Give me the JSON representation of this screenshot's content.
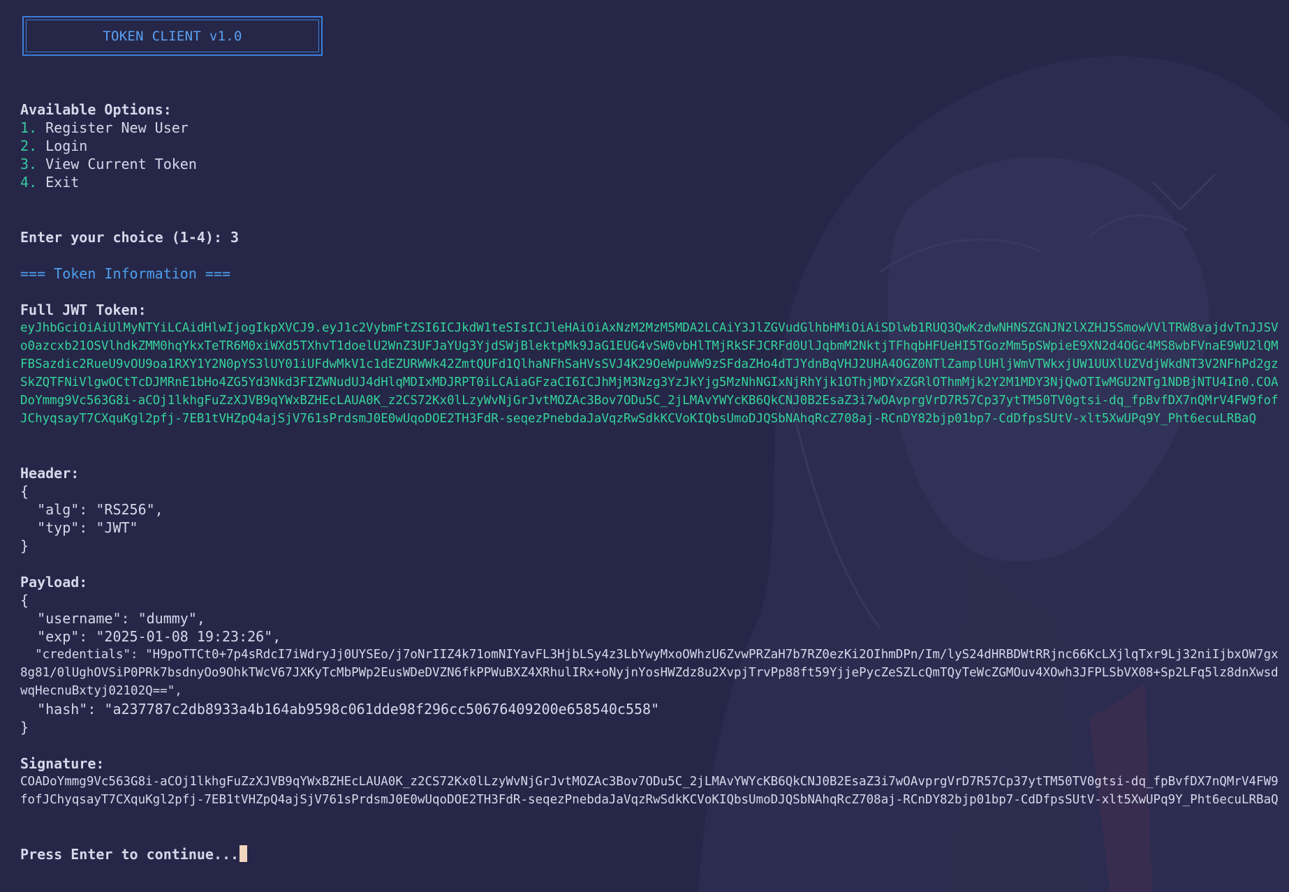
{
  "banner": {
    "title": "TOKEN CLIENT v1.0"
  },
  "menu": {
    "heading": "Available Options:",
    "options": [
      {
        "number": "1.",
        "label": "Register New User"
      },
      {
        "number": "2.",
        "label": "Login"
      },
      {
        "number": "3.",
        "label": "View Current Token"
      },
      {
        "number": "4.",
        "label": "Exit"
      }
    ]
  },
  "prompt": {
    "text": "Enter your choice (1-4):",
    "value": "3"
  },
  "token_info": {
    "heading": "=== Token Information ===",
    "full_token_label": "Full JWT Token:",
    "full_token": "eyJhbGciOiAiUlMyNTYiLCAidHlwIjogIkpXVCJ9.eyJ1c2VybmFtZSI6ICJkdW1teSIsICJleHAiOiAxNzM2MzM5MDA2LCAiY3JlZGVudGlhbHMiOiAiSDlwb1RUQ3QwKzdwNHNSZGNJN2lXZHJ5SmowVVlTRW8vajdvTnJJSVo0azcxb21OSVlhdkZMM0hqYkxTeTR6M0xiWXd5TXhvT1doelU2WnZ3UFJaYUg3YjdSWjBlektpMk9JaG1EUG4vSW0vbHlTMjRkSFJCRFd0UlJqbmM2NktjTFhqbHFUeHI5TGozMm5pSWpieE9XN2d4OGc4MS8wbFVnaE9WU2lQMFBSazdic2RueU9vOU9oa1RXY1Y2N0pYS3lUY01iUFdwMkV1c1dEZURWWk42ZmtQUFd1QlhaNFhSaHVsSVJ4K29OeWpuWW9zSFdaZHo4dTJYdnBqVHJ2UHA4OGZ0NTlZamplUHljWmVTWkxjUW1UUXlUZVdjWkdNT3V2NFhPd2gzSkZQTFNiVlgwOCtTcDJMRnE1bHo4ZG5Yd3Nkd3FIZWNudUJ4dHlqMDIxMDJRPT0iLCAiaGFzaCI6ICJhMjM3Nzg3YzJkYjg5MzNhNGIxNjRhYjk1OThjMDYxZGRlOThmMjk2Y2M1MDY3NjQwOTIwMGU2NTg1NDBjNTU4In0.COADoYmmg9Vc563G8i-aCOj1lkhgFuZzXJVB9qYWxBZHEcLAUA0K_z2CS72Kx0lLzyWvNjGrJvtMOZAc3Bov7ODu5C_2jLMAvYWYcKB6QkCNJ0B2EsaZ3i7wOAvprgVrD7R57Cp37ytTM50TV0gtsi-dq_fpBvfDX7nQMrV4FW9fofJChyqsayT7CXquKgl2pfj-7EB1tVHZpQ4ajSjV761sPrdsmJ0E0wUqoDOE2TH3FdR-seqezPnebdaJaVqzRwSdkKCVoKIQbsUmoDJQSbNAhqRcZ708aj-RCnDY82bjp01bp7-CdDfpsSUtV-xlt5XwUPq9Y_Pht6ecuLRBaQ",
    "header_label": "Header:",
    "header_lines": [
      "{",
      "  \"alg\": \"RS256\",",
      "  \"typ\": \"JWT\"",
      "}"
    ],
    "payload_label": "Payload:",
    "payload_open": "{",
    "payload_username": "  \"username\": \"dummy\",",
    "payload_exp": "  \"exp\": \"2025-01-08 19:23:26\",",
    "payload_credentials": "  \"credentials\": \"H9poTTCt0+7p4sRdcI7iWdryJj0UYSEo/j7oNrIIZ4k71omNIYavFL3HjbLSy4z3LbYwyMxoOWhzU6ZvwPRZaH7b7RZ0ezKi2OIhmDPn/Im/lyS24dHRBDWtRRjnc66KcLXjlqTxr9Lj32niIjbxOW7gx8g81/0lUghOVSiP0PRk7bsdnyOo9OhkTWcV67JXKyTcMbPWp2EusWDeDVZN6fkPPWuBXZ4XRhulIRx+oNyjnYosHWZdz8u2XvpjTrvPp88ft59YjjePycZeSZLcQmTQyTeWcZGMOuv4XOwh3JFPLSbVX08+Sp2LFq5lz8dnXwsdwqHecnuBxtyj02102Q==\",",
    "payload_hash": "  \"hash\": \"a237787c2db8933a4b164ab9598c061dde98f296cc50676409200e658540c558\"",
    "payload_close": "}",
    "signature_label": "Signature:",
    "signature": "COADoYmmg9Vc563G8i-aCOj1lkhgFuZzXJVB9qYWxBZHEcLAUA0K_z2CS72Kx0lLzyWvNjGrJvtMOZAc3Bov7ODu5C_2jLMAvYWYcKB6QkCNJ0B2EsaZ3i7wOAvprgVrD7R57Cp37ytTM50TV0gtsi-dq_fpBvfDX7nQMrV4FW9fofJChyqsayT7CXquKgl2pfj-7EB1tVHZpQ4ajSjV761sPrdsmJ0E0wUqoDOE2TH3FdR-seqezPnebdaJaVqzRwSdkKCVoKIQbsUmoDJQSbNAhqRcZ708aj-RCnDY82bjp01bp7-CdDfpsSUtV-xlt5XwUPq9Y_Pht6ecuLRBaQ"
  },
  "continue_prompt": "Press Enter to continue...",
  "colors": {
    "background": "#262748",
    "text": "#d6d8ea",
    "accent_blue": "#4f9ff0",
    "token_green": "#35d39b",
    "menu_number": "#39c9a0",
    "cursor": "#f1d6bf"
  }
}
